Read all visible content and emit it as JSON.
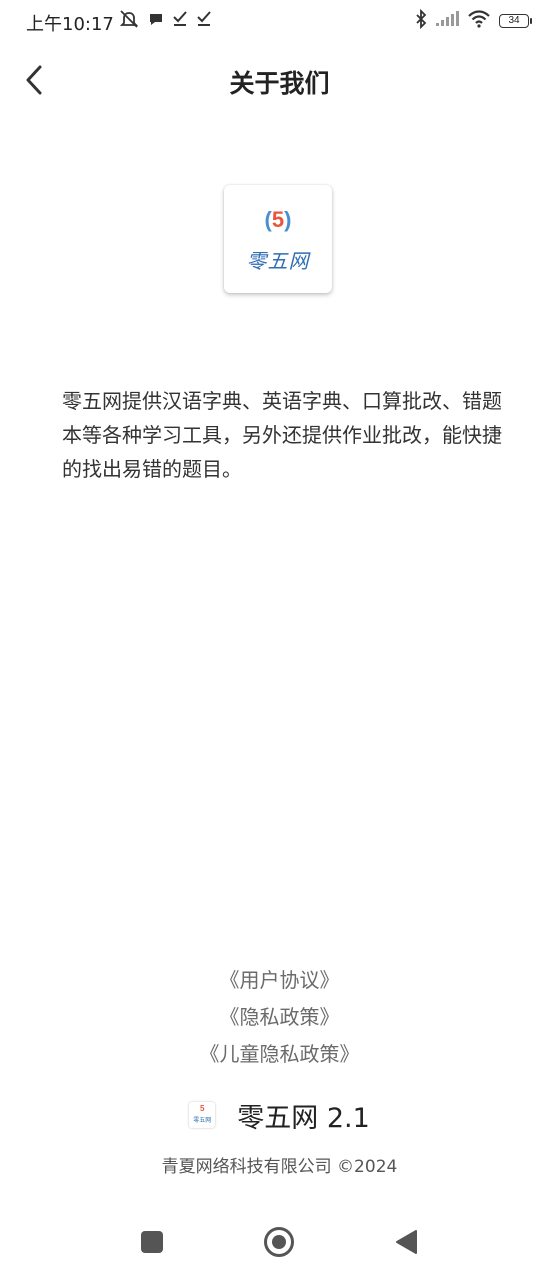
{
  "status_bar": {
    "time": "上午10:17",
    "left_icons": [
      "mute-icon",
      "message-icon",
      "check-icon",
      "check-icon"
    ],
    "right_icons": [
      "bluetooth-icon",
      "signal-icon",
      "wifi-icon"
    ],
    "battery": "34"
  },
  "header": {
    "title": "关于我们",
    "back_icon": "chevron-left-icon"
  },
  "logo": {
    "paren_open": "(",
    "number": "5",
    "paren_close": ")",
    "name": "零五网",
    "colors": {
      "number": "#e8573c",
      "paren": "#4a8fd0",
      "name": "#2f6db4"
    }
  },
  "description": "零五网提供汉语字典、英语字典、口算批改、错题本等各种学习工具，另外还提供作业批改，能快捷的找出易错的题目。",
  "links": [
    {
      "label": "《用户协议》"
    },
    {
      "label": "《隐私政策》"
    },
    {
      "label": "《儿童隐私政策》"
    }
  ],
  "version": {
    "text": "零五网 2.1"
  },
  "copyright": "青夏网络科技有限公司 ©2024",
  "nav_bar": {
    "icons": [
      "square-icon",
      "home-circle-icon",
      "back-triangle-icon"
    ]
  }
}
